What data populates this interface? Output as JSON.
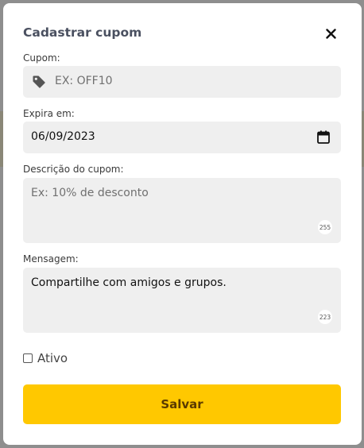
{
  "modal": {
    "title": "Cadastrar cupom",
    "close_icon": "close-icon"
  },
  "fields": {
    "coupon": {
      "label": "Cupom:",
      "placeholder": "EX: OFF10",
      "value": "",
      "icon": "tag-icon"
    },
    "expires": {
      "label": "Expira em:",
      "value": "06/09/2023",
      "icon": "calendar-icon"
    },
    "description": {
      "label": "Descrição do cupom:",
      "placeholder": "Ex: 10% de desconto",
      "value": "",
      "counter": "255"
    },
    "message": {
      "label": "Mensagem:",
      "value": "Compartilhe com amigos e grupos.",
      "counter": "223"
    }
  },
  "active": {
    "label": "Ativo",
    "checked": false
  },
  "save_button": {
    "label": "Salvar"
  },
  "colors": {
    "accent": "#ffc800",
    "field_bg": "#efefef",
    "title": "#4a5060"
  }
}
